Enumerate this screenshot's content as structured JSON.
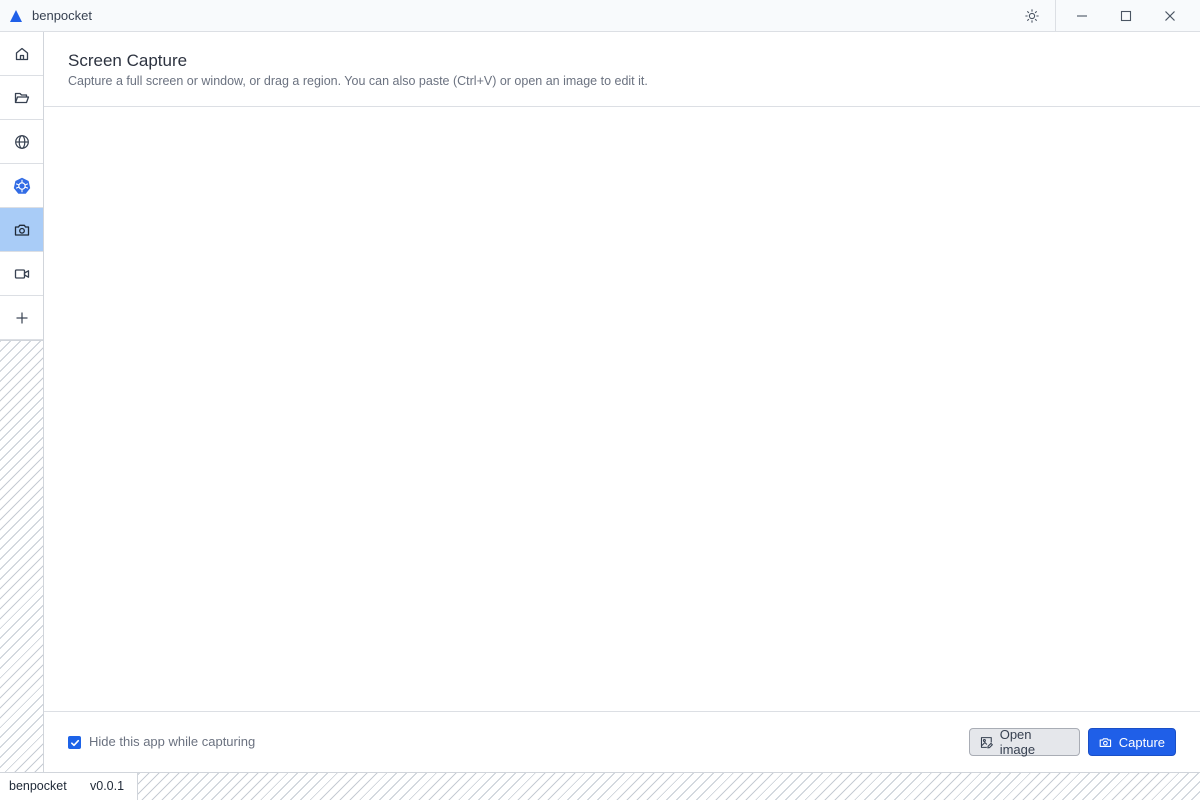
{
  "app": {
    "title": "benpocket",
    "accent_color": "#1f5fe8"
  },
  "window_controls": {
    "theme_icon": "sun-icon",
    "minimize_icon": "minimize-icon",
    "maximize_icon": "maximize-icon",
    "close_icon": "close-icon"
  },
  "sidebar": {
    "items": [
      {
        "name": "home",
        "icon": "home-icon",
        "active": false
      },
      {
        "name": "files",
        "icon": "folder-open-icon",
        "active": false
      },
      {
        "name": "web",
        "icon": "globe-icon",
        "active": false
      },
      {
        "name": "kubernetes",
        "icon": "kubernetes-icon",
        "active": false
      },
      {
        "name": "screen-capture",
        "icon": "camera-icon",
        "active": true
      },
      {
        "name": "video",
        "icon": "video-icon",
        "active": false
      },
      {
        "name": "add",
        "icon": "plus-icon",
        "active": false
      }
    ]
  },
  "header": {
    "title": "Screen Capture",
    "subtitle": "Capture a full screen or window, or drag a region. You can also paste (Ctrl+V) or open an image to edit it."
  },
  "footer": {
    "hide_checkbox_label": "Hide this app while capturing",
    "hide_checkbox_checked": true,
    "open_image_label": "Open image",
    "open_image_icon": "image-edit-icon",
    "capture_label": "Capture",
    "capture_icon": "camera-icon"
  },
  "status": {
    "app_name": "benpocket",
    "version": "v0.0.1"
  }
}
